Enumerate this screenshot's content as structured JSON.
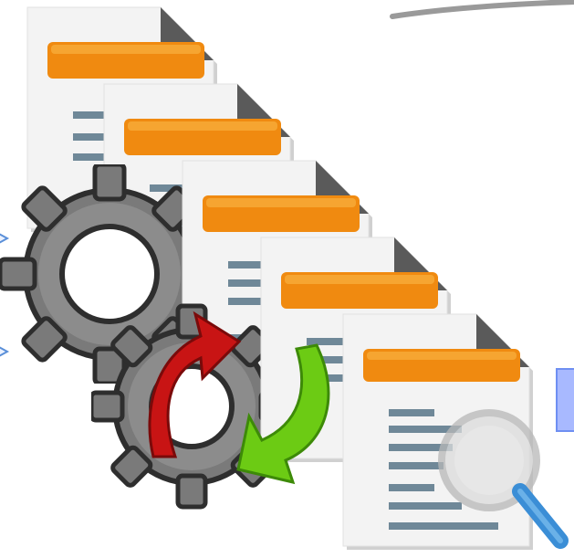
{
  "colors": {
    "page": "#f1f1f1",
    "page_shadow": "#d8d8d8",
    "fold": "#585858",
    "header_bar": "#f08a10",
    "header_bar_light": "#f8b040",
    "text_line": "#6f8898",
    "gear": "#7a7a7a",
    "gear_dark": "#2e2e2e",
    "arrow_red": "#c81414",
    "arrow_green": "#6ccb14",
    "lens_handle": "#3b8ed6",
    "side_box": "#9fb4ff"
  },
  "icons": [
    "document-icon",
    "gear-icon",
    "process-arrow-icon",
    "magnifier-icon",
    "chevron-right-icon"
  ],
  "documents": [
    {
      "name": "document-1"
    },
    {
      "name": "document-2"
    },
    {
      "name": "document-3"
    },
    {
      "name": "document-4"
    },
    {
      "name": "document-5-inspected"
    }
  ]
}
